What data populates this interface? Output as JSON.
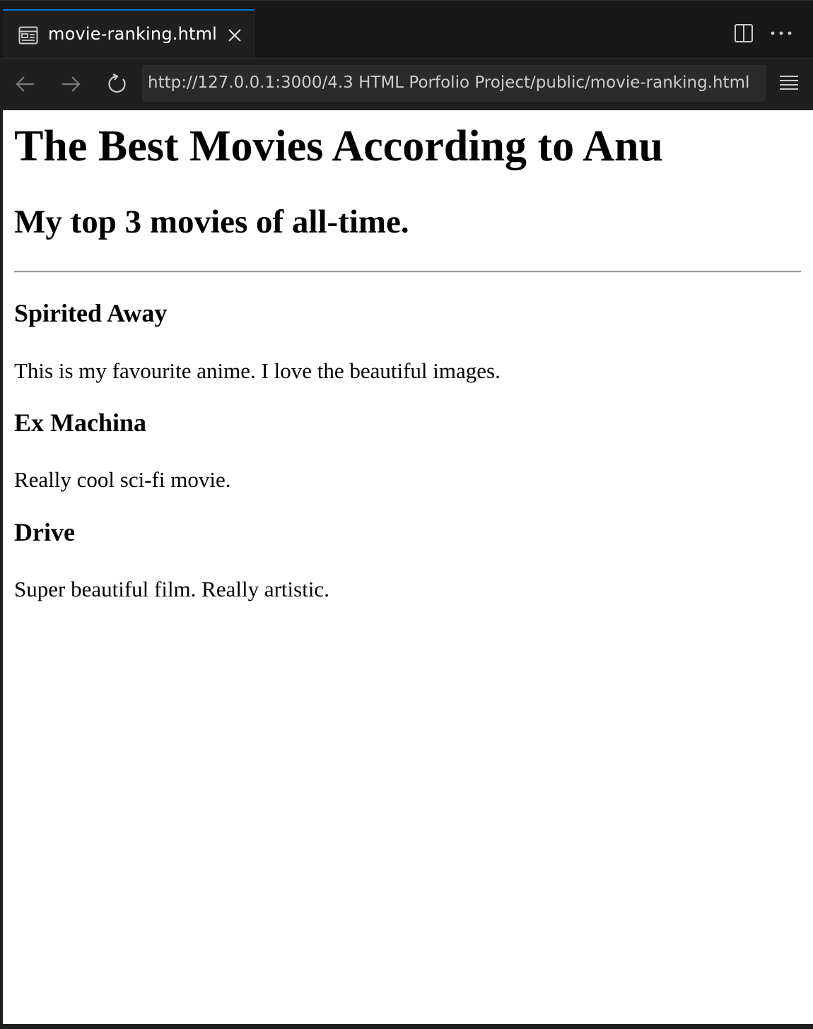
{
  "tab": {
    "label": "movie-ranking.html",
    "icon": "preview-icon",
    "close_icon": "close-icon"
  },
  "toolbar": {
    "split_icon": "split-editor-icon",
    "more_icon": "more-actions-icon"
  },
  "nav": {
    "back_icon": "arrow-left-icon",
    "forward_icon": "arrow-right-icon",
    "reload_icon": "reload-icon",
    "url": "http://127.0.0.1:3000/4.3 HTML Porfolio Project/public/movie-ranking.html",
    "menu_icon": "menu-icon"
  },
  "page": {
    "title": "The Best Movies According to Anu",
    "subtitle": "My top 3 movies of all-time.",
    "movies": [
      {
        "title": "Spirited Away",
        "description": "This is my favourite anime. I love the beautiful images."
      },
      {
        "title": "Ex Machina",
        "description": "Really cool sci-fi movie."
      },
      {
        "title": "Drive",
        "description": "Super beautiful film. Really artistic."
      }
    ]
  },
  "colors": {
    "accent": "#0078d4",
    "chrome_bg": "#1f1f1f",
    "tabbar_bg": "#181818",
    "url_bg": "#2a2a2a",
    "page_bg": "#ffffff"
  }
}
